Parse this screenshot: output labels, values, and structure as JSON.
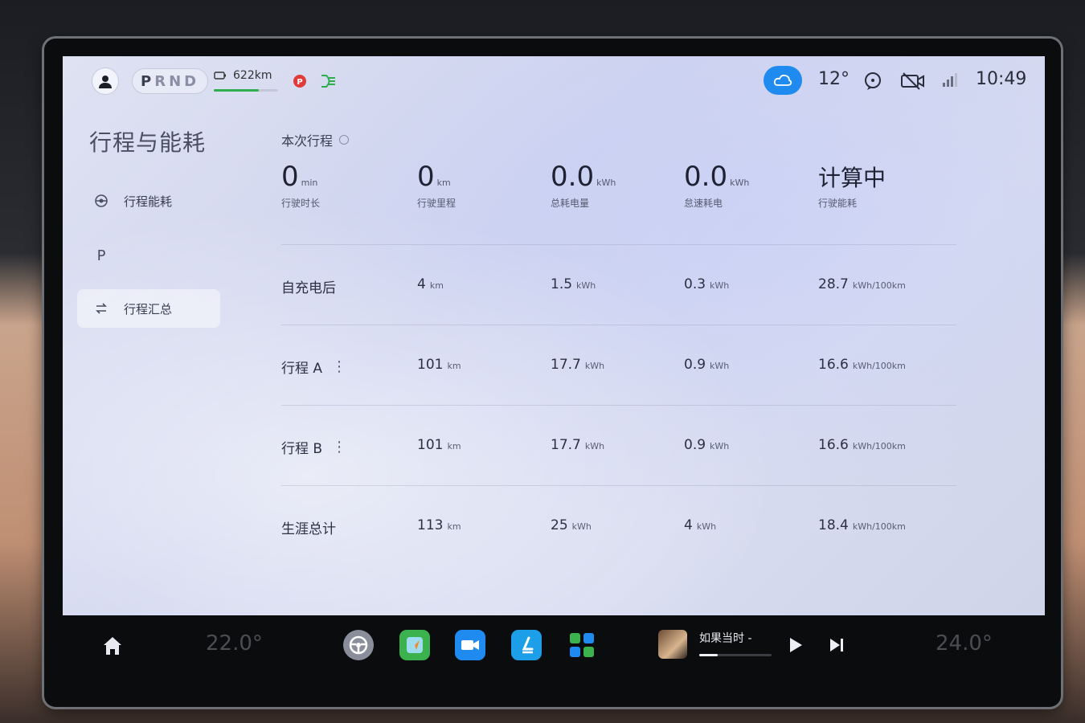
{
  "status": {
    "gear": [
      "P",
      "R",
      "N",
      "D"
    ],
    "active_gear": "P",
    "range": "622km",
    "range_fraction": 0.7,
    "temperature": "12°",
    "time": "10:49",
    "accent": "#1f8bf0"
  },
  "sidebar": {
    "title": "行程与能耗",
    "items": [
      {
        "label": "行程能耗",
        "icon": "target-icon"
      },
      {
        "label": "",
        "icon": "parking-icon",
        "glyph": "P"
      },
      {
        "label": "行程汇总",
        "icon": "swap-icon"
      }
    ]
  },
  "trip": {
    "heading": "本次行程",
    "stats": [
      {
        "value": "0",
        "unit": "min",
        "caption": "行驶时长"
      },
      {
        "value": "0",
        "unit": "km",
        "caption": "行驶里程"
      },
      {
        "value": "0.0",
        "unit": "kWh",
        "caption": "总耗电量"
      },
      {
        "value": "0.0",
        "unit": "kWh",
        "caption": "怠速耗电"
      },
      {
        "value": "计算中",
        "unit": "",
        "caption": "行驶能耗"
      }
    ]
  },
  "rows": [
    {
      "label": "自充电后",
      "menu": false,
      "km": "4",
      "kwh": "1.5",
      "idle": "0.3",
      "eff": "28.7"
    },
    {
      "label": "行程 A",
      "menu": true,
      "km": "101",
      "kwh": "17.7",
      "idle": "0.9",
      "eff": "16.6"
    },
    {
      "label": "行程 B",
      "menu": true,
      "km": "101",
      "kwh": "17.7",
      "idle": "0.9",
      "eff": "16.6"
    },
    {
      "label": "生涯总计",
      "menu": false,
      "km": "113",
      "kwh": "25",
      "idle": "4",
      "eff": "18.4"
    }
  ],
  "units": {
    "km": "km",
    "kwh": "kWh",
    "eff": "kWh/100km"
  },
  "dock": {
    "left_temp": "22.0°",
    "right_temp": "24.0°",
    "apps": [
      "steering-icon",
      "navigation-icon",
      "video-call-icon",
      "seat-icon",
      "apps-grid-icon"
    ],
    "media_title": "如果当时 -",
    "media_progress": 0.25
  }
}
